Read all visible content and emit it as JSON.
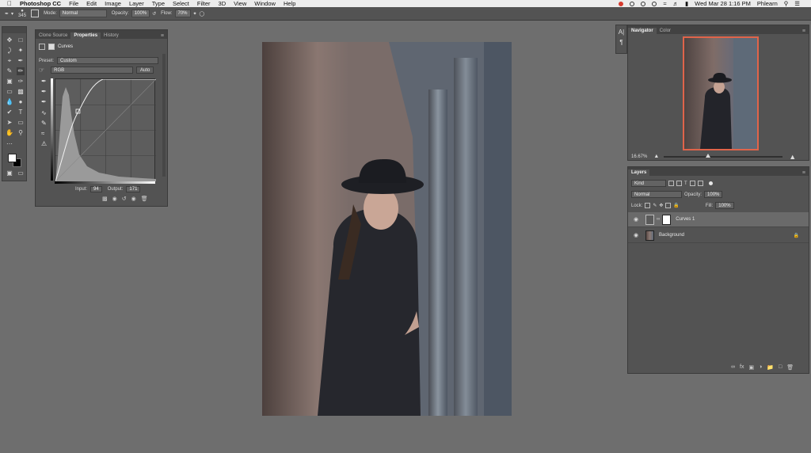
{
  "menubar": {
    "apple_icon": "apple-icon",
    "app_name": "Photoshop CC",
    "items": [
      "File",
      "Edit",
      "Image",
      "Layer",
      "Type",
      "Select",
      "Filter",
      "3D",
      "View",
      "Window",
      "Help"
    ],
    "clock": "Wed Mar 28  1:16 PM",
    "user": "Phlearn"
  },
  "options": {
    "brush_size": "345",
    "mode_label": "Mode:",
    "mode_value": "Normal",
    "opacity_label": "Opacity:",
    "opacity_value": "100%",
    "flow_label": "Flow:",
    "flow_value": "70%"
  },
  "properties": {
    "tabs": [
      "Clone Source",
      "Properties",
      "History"
    ],
    "active_tab": "Properties",
    "adjustment_name": "Curves",
    "preset_label": "Preset:",
    "preset_value": "Custom",
    "channel_value": "RGB",
    "auto_label": "Auto",
    "input_label": "Input:",
    "input_value": "94",
    "output_label": "Output:",
    "output_value": "171"
  },
  "navigator": {
    "tabs": [
      "Navigator",
      "Color"
    ],
    "zoom": "16.67%",
    "zoom_fraction": 0.37
  },
  "layers_panel": {
    "title": "Layers",
    "filter_kind": "Kind",
    "blend_mode": "Normal",
    "opacity_label": "Opacity:",
    "opacity_value": "100%",
    "lock_label": "Lock:",
    "fill_label": "Fill:",
    "fill_value": "100%",
    "layers": [
      {
        "name": "Curves 1",
        "selected": true
      },
      {
        "name": "Background",
        "selected": false
      }
    ]
  },
  "colors": {
    "accent_navigator_frame": "#e0644a",
    "ui_panel": "#535353",
    "workspace": "#6e6e6e"
  }
}
